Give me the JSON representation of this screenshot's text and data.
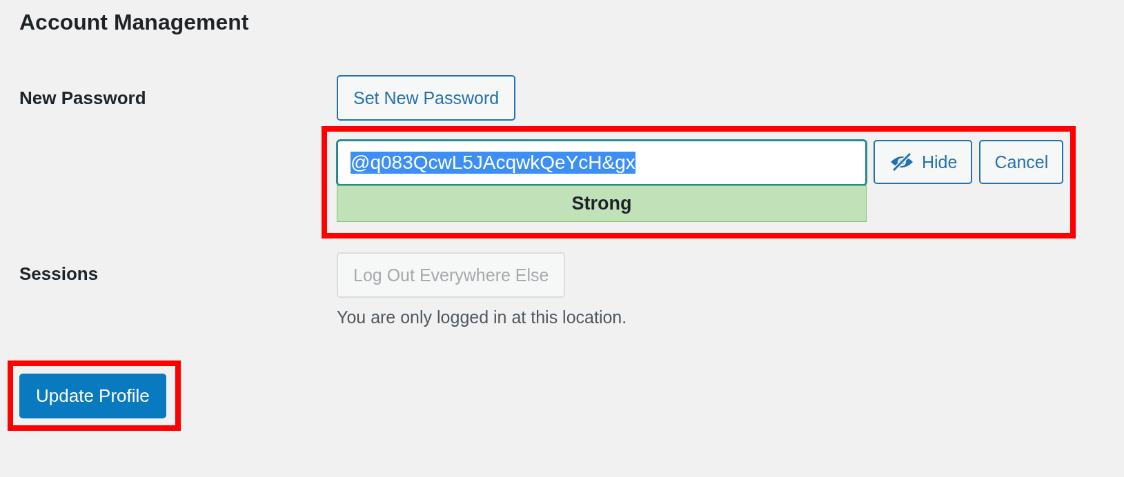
{
  "heading": "Account Management",
  "new_password": {
    "label": "New Password",
    "set_button": "Set New Password",
    "annotated": true,
    "field": {
      "value": "@q083QcwL5JAcqwkQeYcH&gx",
      "text_selected": true
    },
    "strength": {
      "text": "Strong",
      "kind": "strong"
    },
    "hide_button": "Hide",
    "cancel_button": "Cancel"
  },
  "sessions": {
    "label": "Sessions",
    "button": {
      "label": "Log Out Everywhere Else",
      "disabled": true
    },
    "note": "You are only logged in at this location."
  },
  "submit": {
    "label": "Update Profile",
    "annotated": true
  }
}
